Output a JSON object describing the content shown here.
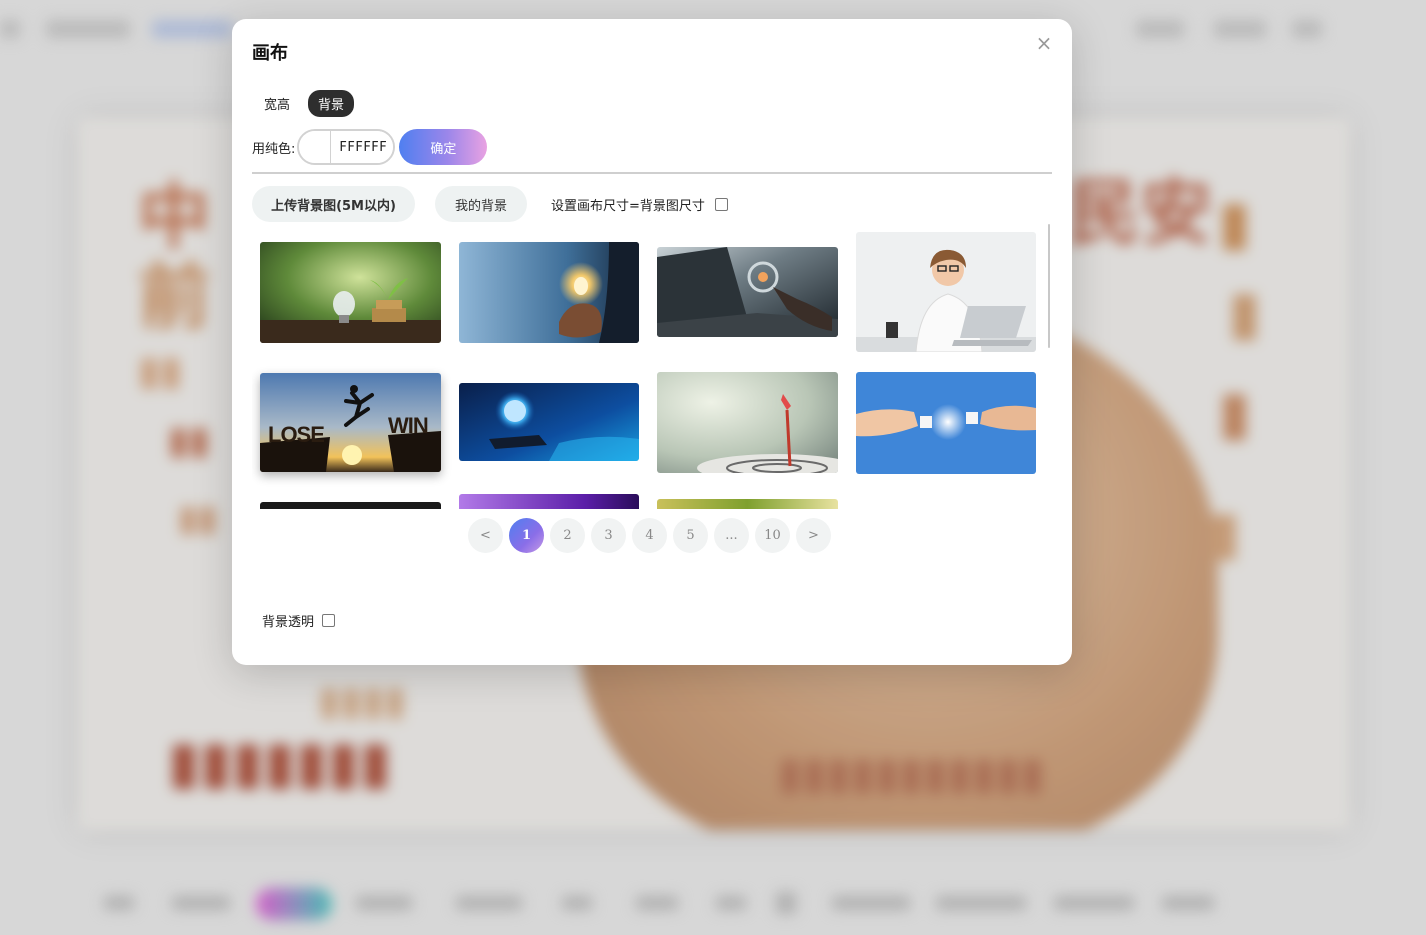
{
  "modal": {
    "title": "画布",
    "close_glyph": "×",
    "tabs": [
      {
        "label": "宽高",
        "active": false
      },
      {
        "label": "背景",
        "active": true
      }
    ],
    "color": {
      "label": "用纯色:",
      "value": "FFFFFF",
      "swatch_color": "#FFFFFF",
      "confirm_label": "确定"
    },
    "actions": {
      "upload_label": "上传背景图(5M以内)",
      "mine_label": "我的背景",
      "size_checkbox_label": "设置画布尺寸=背景图尺寸",
      "size_checkbox_checked": false
    },
    "gallery": {
      "items": [
        {
          "name": "lightbulb-plant-coins"
        },
        {
          "name": "hand-holding-lightbulb"
        },
        {
          "name": "magnifier-laptop"
        },
        {
          "name": "woman-thinking-laptop"
        },
        {
          "name": "lose-win-jump"
        },
        {
          "name": "digital-globe-phone"
        },
        {
          "name": "dart-target"
        },
        {
          "name": "puzzle-hands"
        },
        {
          "name": "dark-partial"
        },
        {
          "name": "purple-partial"
        },
        {
          "name": "green-partial"
        }
      ],
      "embedded_text": {
        "lose": "LOSE",
        "win": "WIN"
      }
    },
    "pagination": {
      "prev": "<",
      "next": ">",
      "pages": [
        "1",
        "2",
        "3",
        "4",
        "5",
        "...",
        "10"
      ],
      "current": "1"
    },
    "transparent": {
      "label": "背景透明",
      "checked": false
    }
  },
  "colors": {
    "accent_start": "#4f7ff0",
    "accent_end": "#e9a2e2",
    "tab_active_bg": "#2e2e2e"
  }
}
